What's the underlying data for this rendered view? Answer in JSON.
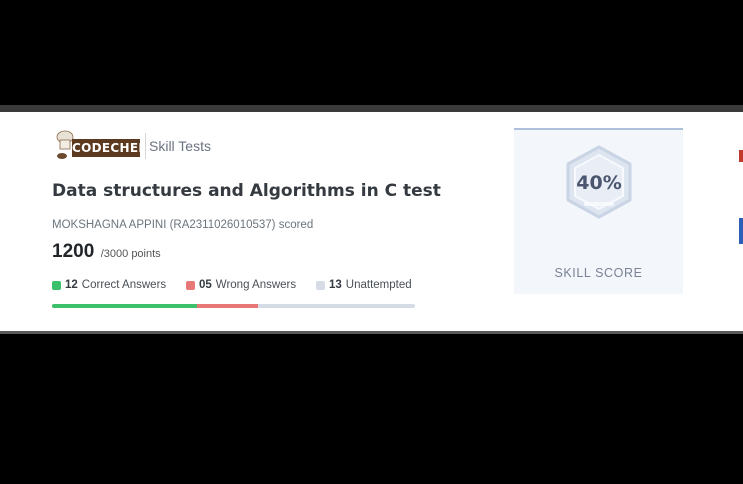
{
  "brand": {
    "logo_text": "CODECHEF",
    "product": "Skill Tests"
  },
  "test": {
    "title": "Data structures and Algorithms in C test",
    "scored_line": "MOKSHAGNA APPINI (RA2311026010537) scored",
    "score": "1200",
    "total": "/3000 points"
  },
  "results": {
    "correct": {
      "count": "12",
      "label": "Correct Answers",
      "color": "#3cc06a"
    },
    "wrong": {
      "count": "05",
      "label": "Wrong Answers",
      "color": "#e87878"
    },
    "unattempted": {
      "count": "13",
      "label": "Unattempted",
      "color": "#d5dce6"
    }
  },
  "progress": {
    "correct_fraction": 0.4,
    "wrong_fraction": 0.1667,
    "unattempted_fraction": 0.4333
  },
  "skill": {
    "percent": "40%",
    "label": "SKILL SCORE"
  }
}
